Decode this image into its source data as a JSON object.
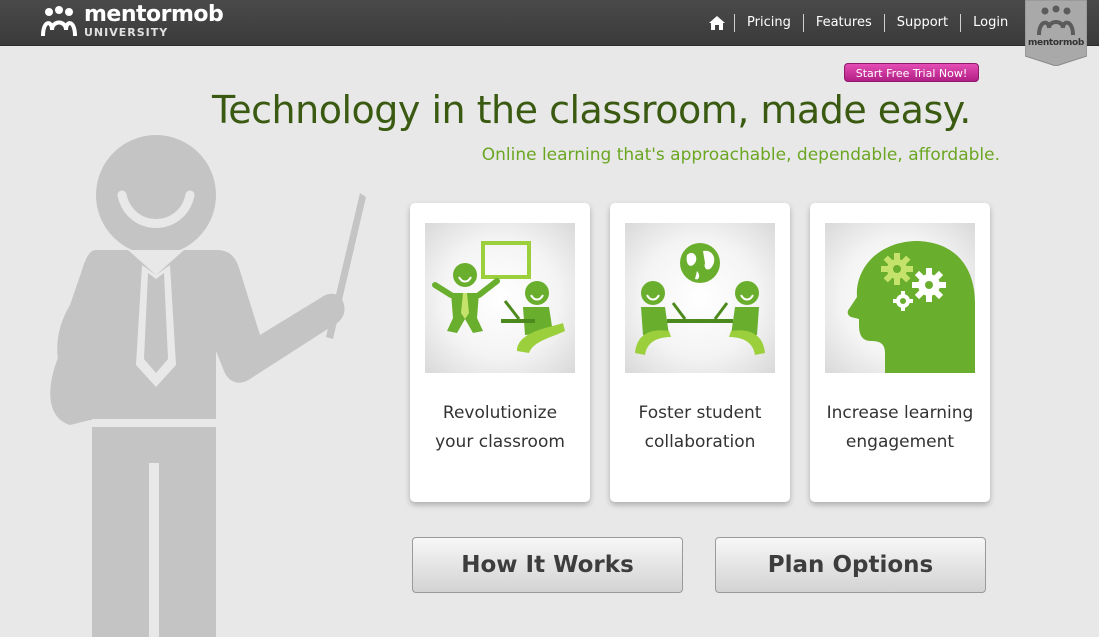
{
  "brand": {
    "name": "mentormob",
    "sub": "UNIVERSITY",
    "badge_text": "mentormob"
  },
  "nav": {
    "links": [
      "Pricing",
      "Features",
      "Support",
      "Login"
    ]
  },
  "trial_button": "Start Free Trial Now!",
  "hero": {
    "headline": "Technology in the classroom, made easy.",
    "subheadline": "Online learning that's approachable, dependable, affordable."
  },
  "cards": [
    {
      "line1": "Revolutionize",
      "line2": "your classroom"
    },
    {
      "line1": "Foster student",
      "line2": "collaboration"
    },
    {
      "line1": "Increase learning",
      "line2": "engagement"
    }
  ],
  "buttons": {
    "how_it_works": "How It Works",
    "plan_options": "Plan Options"
  },
  "colors": {
    "brand_green_dark": "#3a5a12",
    "brand_green": "#6ba622",
    "trial_pink": "#d63aa4",
    "topbar": "#424242"
  }
}
